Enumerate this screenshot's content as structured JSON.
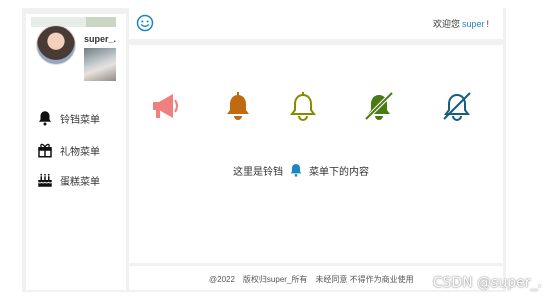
{
  "profile": {
    "username": "super_."
  },
  "sidebar": {
    "items": [
      {
        "label": "铃铛菜单",
        "icon": "bell-icon"
      },
      {
        "label": "礼物菜单",
        "icon": "gift-icon"
      },
      {
        "label": "蛋糕菜单",
        "icon": "cake-icon"
      }
    ]
  },
  "header": {
    "icon": "smile-icon",
    "welcome_prefix": "欢迎您",
    "welcome_user": "super",
    "welcome_suffix": "!"
  },
  "main": {
    "icons": [
      {
        "name": "megaphone-icon",
        "color": "#f08080"
      },
      {
        "name": "bell-solid-icon",
        "color": "#c06a12"
      },
      {
        "name": "bell-outline-icon",
        "color": "#8a8a00"
      },
      {
        "name": "bell-slash-solid-icon",
        "color": "#4a7a12"
      },
      {
        "name": "bell-slash-outline-icon",
        "color": "#165d7f"
      }
    ],
    "caption_before": "这里是铃铛",
    "caption_icon": "bell-icon",
    "caption_icon_color": "#1b86c2",
    "caption_after": "菜单下的内容"
  },
  "footer": {
    "year": "@2022",
    "rights": "版权归super_所有",
    "notice": "未经同意 不得作为商业使用"
  },
  "watermark": "CSDN @super_."
}
